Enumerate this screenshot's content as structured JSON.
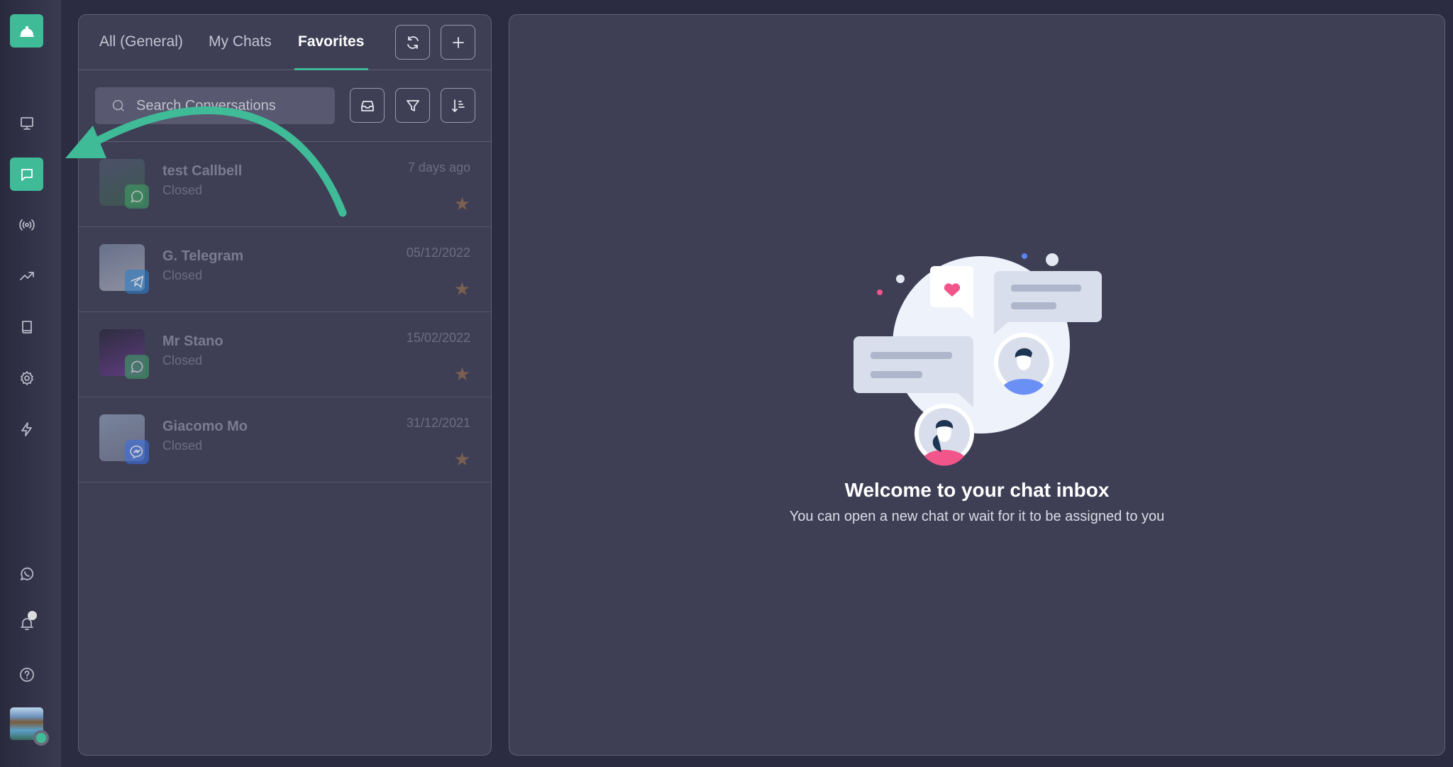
{
  "sidebar": {
    "items": [
      "bell-logo",
      "monitor",
      "chat",
      "broadcast",
      "trends",
      "book",
      "settings",
      "bolt",
      "whatsapp",
      "notifications",
      "help",
      "profile"
    ],
    "active": "chat",
    "accent": "#3fbb97"
  },
  "tabs": [
    {
      "label": "All (General)"
    },
    {
      "label": "My Chats"
    },
    {
      "label": "Favorites",
      "active": true
    }
  ],
  "search": {
    "placeholder": "Search Conversations"
  },
  "conversations": [
    {
      "name": "test Callbell",
      "status": "Closed",
      "date": "7 days ago",
      "channel": "whatsapp",
      "starred": true
    },
    {
      "name": "G. Telegram",
      "status": "Closed",
      "date": "05/12/2022",
      "channel": "telegram",
      "starred": true
    },
    {
      "name": "Mr Stano",
      "status": "Closed",
      "date": "15/02/2022",
      "channel": "whatsapp",
      "starred": true
    },
    {
      "name": "Giacomo Mo",
      "status": "Closed",
      "date": "31/12/2021",
      "channel": "messenger",
      "starred": true
    }
  ],
  "main": {
    "title": "Welcome to your chat inbox",
    "subtitle": "You can open a new chat or wait for it to be assigned to you"
  },
  "star_glyph": "★"
}
